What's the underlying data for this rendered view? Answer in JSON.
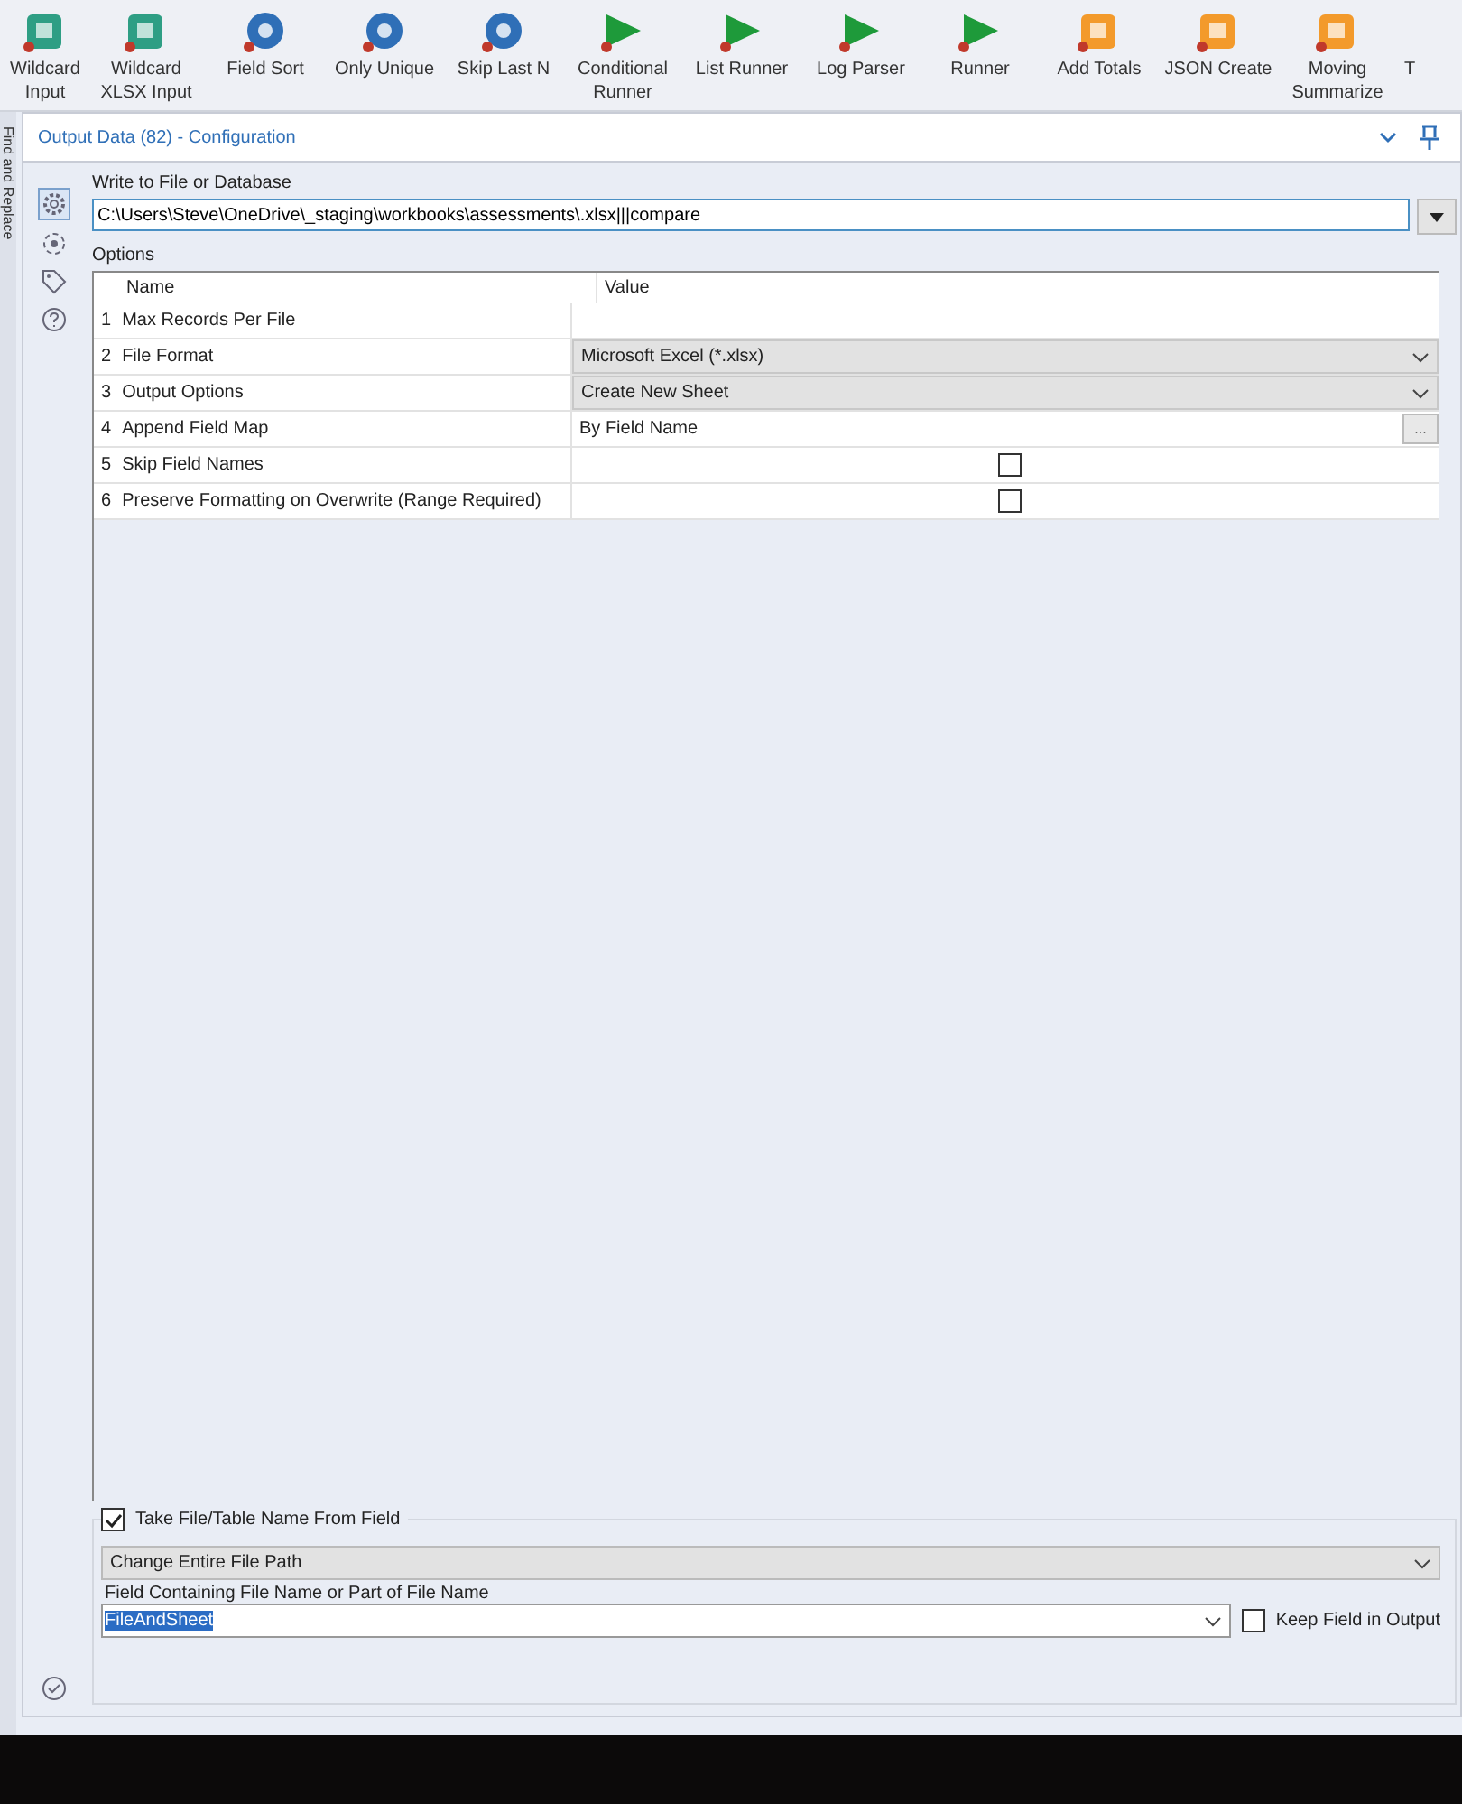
{
  "toolbar": {
    "tools": [
      {
        "label": "Wildcard Input",
        "kind": "square",
        "color": "#2e9e84"
      },
      {
        "label": "Wildcard XLSX Input",
        "kind": "square",
        "color": "#2e9e84"
      },
      {
        "label": "Field Sort",
        "kind": "circle",
        "color": "#2f6fb7"
      },
      {
        "label": "Only Unique",
        "kind": "circle",
        "color": "#2f6fb7"
      },
      {
        "label": "Skip Last N",
        "kind": "circle",
        "color": "#2f6fb7"
      },
      {
        "label": "Conditional Runner",
        "kind": "triangle",
        "color": "#1e9a3a"
      },
      {
        "label": "List Runner",
        "kind": "triangle",
        "color": "#1e9a3a"
      },
      {
        "label": "Log Parser",
        "kind": "triangle",
        "color": "#1e9a3a"
      },
      {
        "label": "Runner",
        "kind": "triangle",
        "color": "#1e9a3a"
      },
      {
        "label": "Add Totals",
        "kind": "square",
        "color": "#f39a2b"
      },
      {
        "label": "JSON Create",
        "kind": "square",
        "color": "#f39a2b"
      },
      {
        "label": "Moving Summarize",
        "kind": "square",
        "color": "#f39a2b"
      },
      {
        "label": "T",
        "kind": "none"
      }
    ]
  },
  "side_tab": {
    "label": "Find and Replace"
  },
  "panel": {
    "title": "Output Data (82) - Configuration"
  },
  "side_icons": [
    {
      "kind": "gear",
      "selected": true
    },
    {
      "kind": "target",
      "selected": false
    },
    {
      "kind": "tag",
      "selected": false
    },
    {
      "kind": "help",
      "selected": false
    }
  ],
  "write_to": {
    "label": "Write to File or Database",
    "value": "C:\\Users\\Steve\\OneDrive\\_staging\\workbooks\\assessments\\.xlsx|||compare"
  },
  "options": {
    "label": "Options",
    "columns": [
      "Name",
      "Value"
    ],
    "rows": [
      {
        "number": "1",
        "name": "Max Records Per File",
        "kind": "text"
      },
      {
        "number": "2",
        "name": "File Format",
        "kind": "dropdown",
        "value": "Microsoft Excel (*.xlsx)"
      },
      {
        "number": "3",
        "name": "Output Options",
        "kind": "dropdown",
        "value": "Create New Sheet"
      },
      {
        "number": "4",
        "name": "Append Field Map",
        "kind": "ellipsis",
        "value": "By Field Name",
        "button": "..."
      },
      {
        "number": "5",
        "name": "Skip Field Names",
        "kind": "checkbox",
        "checked": false
      },
      {
        "number": "6",
        "name": "Preserve Formatting on Overwrite (Range Required)",
        "kind": "checkbox",
        "checked": false
      }
    ]
  },
  "take_name": {
    "label": "Take File/Table Name From Field",
    "checked": true,
    "mode": "Change Entire File Path",
    "field_label": "Field Containing File Name or Part of File Name",
    "field_value": "FileAndSheet",
    "keep": {
      "label": "Keep Field in Output",
      "checked": false
    }
  }
}
